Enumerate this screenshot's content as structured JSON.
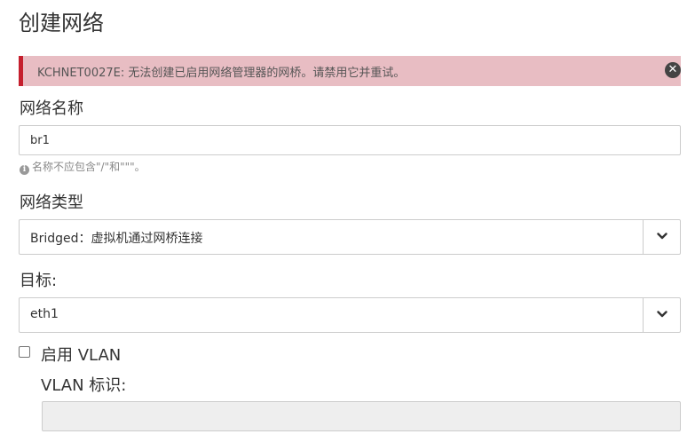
{
  "dialog": {
    "title": "创建网络"
  },
  "alert": {
    "message": "KCHNET0027E: 无法创建已启用网络管理器的网桥。请禁用它并重试。",
    "close_glyph": "✕",
    "color": "#c51f2d"
  },
  "network_name": {
    "label": "网络名称",
    "value": "br1",
    "help_icon": "info-icon",
    "help_text": "名称不应包含\"/\"和\"\"\"。"
  },
  "network_type": {
    "label": "网络类型",
    "selected": "Bridged：虚拟机通过网桥连接",
    "icon": "chevron-down-icon"
  },
  "destination": {
    "label": "目标:",
    "selected": "eth1",
    "icon": "chevron-down-icon"
  },
  "vlan": {
    "enable_label": "启用 VLAN",
    "enabled": false,
    "id_label": "VLAN 标识:",
    "id_value": ""
  }
}
